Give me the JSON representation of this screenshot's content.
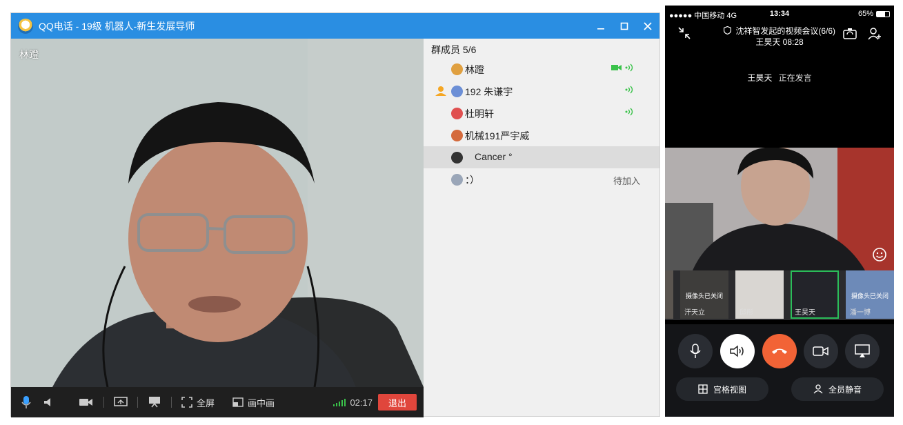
{
  "desktop": {
    "window_title": "QQ电话 - 19级 机器人-新生发展导师",
    "speaker_name": "林蹬",
    "controls": {
      "fullscreen_label": "全屏",
      "pip_label": "画中画",
      "timer": "02:17",
      "exit_label": "退出"
    },
    "members": {
      "title": "群成员 5/6",
      "list": [
        {
          "name": "林蹬"
        },
        {
          "name": "192 朱谦宇"
        },
        {
          "name": "杜明轩"
        },
        {
          "name": "机械191严宇威"
        },
        {
          "name": "Cancer °"
        },
        {
          "name": "：）",
          "status": "待加入"
        }
      ]
    }
  },
  "phone": {
    "status": {
      "carrier": "●●●●● 中国移动  4G",
      "time": "13:34",
      "battery": "65%"
    },
    "meeting_title": "沈祥智发起的视频会议(6/6)",
    "meeting_sub": "王昊天 08:28",
    "speaking_name": "王昊天",
    "speaking_label": "正在发言",
    "thumbnails": [
      {
        "name": "",
        "cam_off": ""
      },
      {
        "name": "汗天立",
        "cam_off": "摄像头已关闭"
      },
      {
        "name": "邱彤",
        "cam_off": ""
      },
      {
        "name": "王昊天",
        "cam_off": ""
      },
      {
        "name": "潘一博",
        "cam_off": "摄像头已关闭"
      }
    ],
    "grid_view_label": "宫格视图",
    "mute_all_label": "全员静音"
  },
  "colors": {
    "title_bar": "#2a8ee2",
    "exit_button": "#e0463c",
    "hangup": "#f26336",
    "active_thumb": "#2bbd5a",
    "voice_green": "#3ac24a"
  }
}
